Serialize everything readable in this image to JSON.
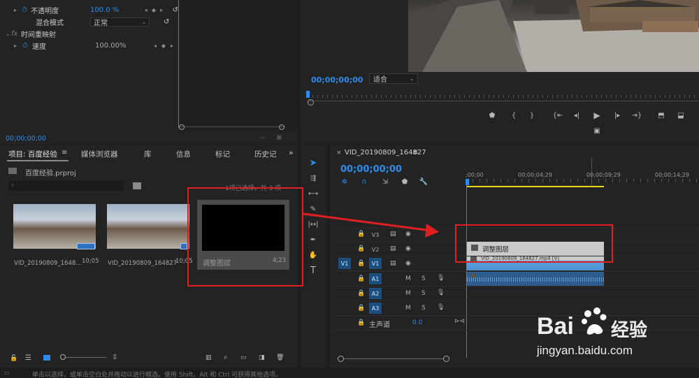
{
  "effect_controls": {
    "opacity_label": "不透明度",
    "opacity_value": "100.0 %",
    "blend_label": "混合模式",
    "blend_value": "正常",
    "time_remap_label": "时间重映射",
    "speed_label": "速度",
    "speed_value": "100.00%",
    "timecode": "00;00;00;00"
  },
  "program_monitor": {
    "timecode": "00;00;00;00",
    "fit_label": "适合"
  },
  "project_panel": {
    "tabs": [
      "项目: 百度经验",
      "媒体浏览器",
      "库",
      "信息",
      "标记",
      "历史记"
    ],
    "file_name": "百度经验.prproj",
    "selection_info": "1项已选择，共 3 项",
    "items": [
      {
        "name": "VID_20190809_1648...",
        "duration": "10;05"
      },
      {
        "name": "VID_20190809_164827",
        "duration": "10;05"
      },
      {
        "name": "调整图层",
        "duration": "4;23"
      }
    ]
  },
  "timeline": {
    "sequence_name": "VID_20190809_164827",
    "timecode": "00;00;00;00",
    "ruler": [
      ";00;00",
      "00;00;04;29",
      "00;00;09;29",
      "00;00;14;29"
    ],
    "video_tracks": [
      "V3",
      "V2",
      "V1"
    ],
    "audio_tracks": [
      "A1",
      "A2",
      "A3"
    ],
    "source_patch": "V1",
    "master_label": "主声道",
    "master_value": "0.0",
    "adjustment_clip": "调整图层",
    "video_clip": "VID_20190809_164827.mp4 [V]",
    "m_label": "M",
    "s_label": "S"
  },
  "status_bar": {
    "text": "单击以选择，或单击空白处并拖动以进行框选。使用 Shift、Alt 和 Ctrl 可获得其他选项。"
  },
  "watermark": {
    "brand": "Bai",
    "brand2": "经验",
    "url": "jingyan.baidu.com"
  },
  "colors": {
    "accent_blue": "#2d8ceb",
    "track_blue": "#1a4f80",
    "annotation_red": "#e02020",
    "work_area_yellow": "#e8d21a"
  }
}
